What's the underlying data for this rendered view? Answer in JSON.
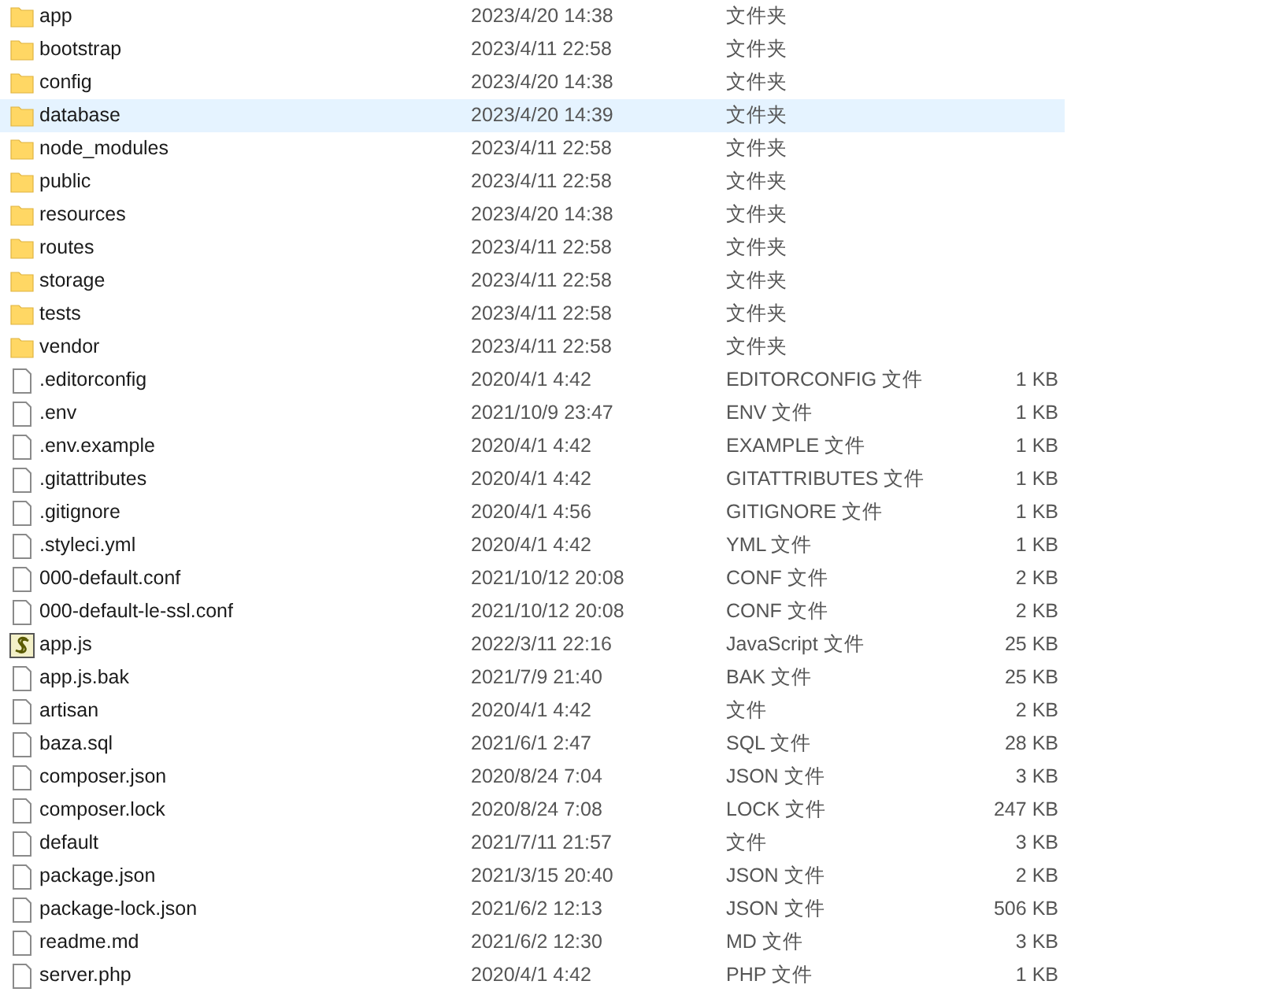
{
  "files": [
    {
      "kind": "folder",
      "name": "app",
      "date": "2023/4/20 14:38",
      "type": "文件夹",
      "selected": false
    },
    {
      "kind": "folder",
      "name": "bootstrap",
      "date": "2023/4/11 22:58",
      "type": "文件夹",
      "selected": false
    },
    {
      "kind": "folder",
      "name": "config",
      "date": "2023/4/20 14:38",
      "type": "文件夹",
      "selected": false
    },
    {
      "kind": "folder",
      "name": "database",
      "date": "2023/4/20 14:39",
      "type": "文件夹",
      "selected": true
    },
    {
      "kind": "folder",
      "name": "node_modules",
      "date": "2023/4/11 22:58",
      "type": "文件夹",
      "selected": false
    },
    {
      "kind": "folder",
      "name": "public",
      "date": "2023/4/11 22:58",
      "type": "文件夹",
      "selected": false
    },
    {
      "kind": "folder",
      "name": "resources",
      "date": "2023/4/20 14:38",
      "type": "文件夹",
      "selected": false
    },
    {
      "kind": "folder",
      "name": "routes",
      "date": "2023/4/11 22:58",
      "type": "文件夹",
      "selected": false
    },
    {
      "kind": "folder",
      "name": "storage",
      "date": "2023/4/11 22:58",
      "type": "文件夹",
      "selected": false
    },
    {
      "kind": "folder",
      "name": "tests",
      "date": "2023/4/11 22:58",
      "type": "文件夹",
      "selected": false
    },
    {
      "kind": "folder",
      "name": "vendor",
      "date": "2023/4/11 22:58",
      "type": "文件夹",
      "selected": false
    },
    {
      "kind": "file",
      "name": ".editorconfig",
      "date": "2020/4/1 4:42",
      "type": "EDITORCONFIG 文件",
      "size": "1 KB",
      "selected": false
    },
    {
      "kind": "file",
      "name": ".env",
      "date": "2021/10/9 23:47",
      "type": "ENV 文件",
      "size": "1 KB",
      "selected": false
    },
    {
      "kind": "file",
      "name": ".env.example",
      "date": "2020/4/1 4:42",
      "type": "EXAMPLE 文件",
      "size": "1 KB",
      "selected": false
    },
    {
      "kind": "file",
      "name": ".gitattributes",
      "date": "2020/4/1 4:42",
      "type": "GITATTRIBUTES 文件",
      "size": "1 KB",
      "selected": false
    },
    {
      "kind": "file",
      "name": ".gitignore",
      "date": "2020/4/1 4:56",
      "type": "GITIGNORE 文件",
      "size": "1 KB",
      "selected": false
    },
    {
      "kind": "file",
      "name": ".styleci.yml",
      "date": "2020/4/1 4:42",
      "type": "YML 文件",
      "size": "1 KB",
      "selected": false
    },
    {
      "kind": "file",
      "name": "000-default.conf",
      "date": "2021/10/12 20:08",
      "type": "CONF 文件",
      "size": "2 KB",
      "selected": false
    },
    {
      "kind": "file",
      "name": "000-default-le-ssl.conf",
      "date": "2021/10/12 20:08",
      "type": "CONF 文件",
      "size": "2 KB",
      "selected": false
    },
    {
      "kind": "script",
      "name": "app.js",
      "date": "2022/3/11 22:16",
      "type": "JavaScript 文件",
      "size": "25 KB",
      "selected": false
    },
    {
      "kind": "file",
      "name": "app.js.bak",
      "date": "2021/7/9 21:40",
      "type": "BAK 文件",
      "size": "25 KB",
      "selected": false
    },
    {
      "kind": "file",
      "name": "artisan",
      "date": "2020/4/1 4:42",
      "type": "文件",
      "size": "2 KB",
      "selected": false
    },
    {
      "kind": "file",
      "name": "baza.sql",
      "date": "2021/6/1 2:47",
      "type": "SQL 文件",
      "size": "28 KB",
      "selected": false
    },
    {
      "kind": "file",
      "name": "composer.json",
      "date": "2020/8/24 7:04",
      "type": "JSON 文件",
      "size": "3 KB",
      "selected": false
    },
    {
      "kind": "file",
      "name": "composer.lock",
      "date": "2020/8/24 7:08",
      "type": "LOCK 文件",
      "size": "247 KB",
      "selected": false
    },
    {
      "kind": "file",
      "name": "default",
      "date": "2021/7/11 21:57",
      "type": "文件",
      "size": "3 KB",
      "selected": false
    },
    {
      "kind": "file",
      "name": "package.json",
      "date": "2021/3/15 20:40",
      "type": "JSON 文件",
      "size": "2 KB",
      "selected": false
    },
    {
      "kind": "file",
      "name": "package-lock.json",
      "date": "2021/6/2 12:13",
      "type": "JSON 文件",
      "size": "506 KB",
      "selected": false
    },
    {
      "kind": "file",
      "name": "readme.md",
      "date": "2021/6/2 12:30",
      "type": "MD 文件",
      "size": "3 KB",
      "selected": false
    },
    {
      "kind": "file",
      "name": "server.php",
      "date": "2020/4/1 4:42",
      "type": "PHP 文件",
      "size": "1 KB",
      "selected": false
    }
  ]
}
